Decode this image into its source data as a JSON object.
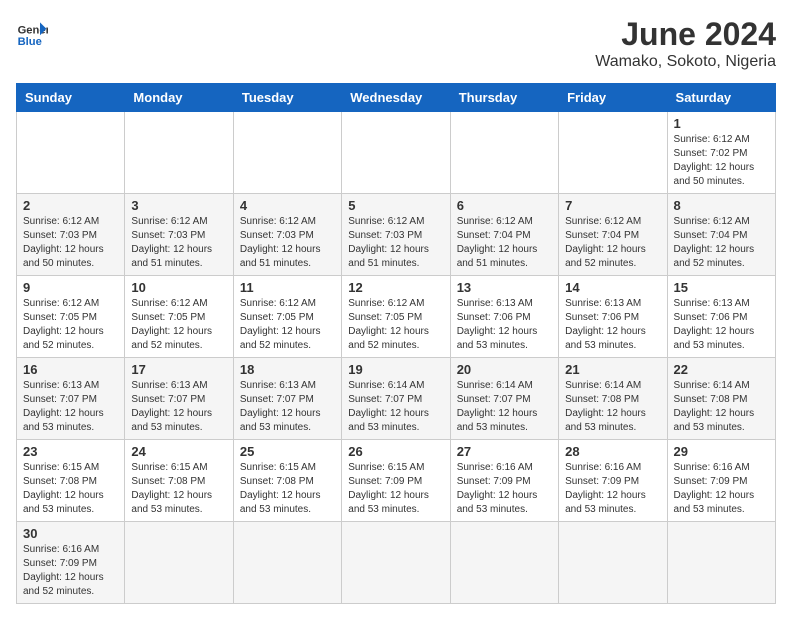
{
  "header": {
    "logo_general": "General",
    "logo_blue": "Blue",
    "title": "June 2024",
    "subtitle": "Wamako, Sokoto, Nigeria"
  },
  "weekdays": [
    "Sunday",
    "Monday",
    "Tuesday",
    "Wednesday",
    "Thursday",
    "Friday",
    "Saturday"
  ],
  "weeks": [
    [
      {
        "day": "",
        "info": ""
      },
      {
        "day": "",
        "info": ""
      },
      {
        "day": "",
        "info": ""
      },
      {
        "day": "",
        "info": ""
      },
      {
        "day": "",
        "info": ""
      },
      {
        "day": "",
        "info": ""
      },
      {
        "day": "1",
        "info": "Sunrise: 6:12 AM\nSunset: 7:02 PM\nDaylight: 12 hours and 50 minutes."
      }
    ],
    [
      {
        "day": "2",
        "info": "Sunrise: 6:12 AM\nSunset: 7:03 PM\nDaylight: 12 hours and 50 minutes."
      },
      {
        "day": "3",
        "info": "Sunrise: 6:12 AM\nSunset: 7:03 PM\nDaylight: 12 hours and 51 minutes."
      },
      {
        "day": "4",
        "info": "Sunrise: 6:12 AM\nSunset: 7:03 PM\nDaylight: 12 hours and 51 minutes."
      },
      {
        "day": "5",
        "info": "Sunrise: 6:12 AM\nSunset: 7:03 PM\nDaylight: 12 hours and 51 minutes."
      },
      {
        "day": "6",
        "info": "Sunrise: 6:12 AM\nSunset: 7:04 PM\nDaylight: 12 hours and 51 minutes."
      },
      {
        "day": "7",
        "info": "Sunrise: 6:12 AM\nSunset: 7:04 PM\nDaylight: 12 hours and 52 minutes."
      },
      {
        "day": "8",
        "info": "Sunrise: 6:12 AM\nSunset: 7:04 PM\nDaylight: 12 hours and 52 minutes."
      }
    ],
    [
      {
        "day": "9",
        "info": "Sunrise: 6:12 AM\nSunset: 7:05 PM\nDaylight: 12 hours and 52 minutes."
      },
      {
        "day": "10",
        "info": "Sunrise: 6:12 AM\nSunset: 7:05 PM\nDaylight: 12 hours and 52 minutes."
      },
      {
        "day": "11",
        "info": "Sunrise: 6:12 AM\nSunset: 7:05 PM\nDaylight: 12 hours and 52 minutes."
      },
      {
        "day": "12",
        "info": "Sunrise: 6:12 AM\nSunset: 7:05 PM\nDaylight: 12 hours and 52 minutes."
      },
      {
        "day": "13",
        "info": "Sunrise: 6:13 AM\nSunset: 7:06 PM\nDaylight: 12 hours and 53 minutes."
      },
      {
        "day": "14",
        "info": "Sunrise: 6:13 AM\nSunset: 7:06 PM\nDaylight: 12 hours and 53 minutes."
      },
      {
        "day": "15",
        "info": "Sunrise: 6:13 AM\nSunset: 7:06 PM\nDaylight: 12 hours and 53 minutes."
      }
    ],
    [
      {
        "day": "16",
        "info": "Sunrise: 6:13 AM\nSunset: 7:07 PM\nDaylight: 12 hours and 53 minutes."
      },
      {
        "day": "17",
        "info": "Sunrise: 6:13 AM\nSunset: 7:07 PM\nDaylight: 12 hours and 53 minutes."
      },
      {
        "day": "18",
        "info": "Sunrise: 6:13 AM\nSunset: 7:07 PM\nDaylight: 12 hours and 53 minutes."
      },
      {
        "day": "19",
        "info": "Sunrise: 6:14 AM\nSunset: 7:07 PM\nDaylight: 12 hours and 53 minutes."
      },
      {
        "day": "20",
        "info": "Sunrise: 6:14 AM\nSunset: 7:07 PM\nDaylight: 12 hours and 53 minutes."
      },
      {
        "day": "21",
        "info": "Sunrise: 6:14 AM\nSunset: 7:08 PM\nDaylight: 12 hours and 53 minutes."
      },
      {
        "day": "22",
        "info": "Sunrise: 6:14 AM\nSunset: 7:08 PM\nDaylight: 12 hours and 53 minutes."
      }
    ],
    [
      {
        "day": "23",
        "info": "Sunrise: 6:15 AM\nSunset: 7:08 PM\nDaylight: 12 hours and 53 minutes."
      },
      {
        "day": "24",
        "info": "Sunrise: 6:15 AM\nSunset: 7:08 PM\nDaylight: 12 hours and 53 minutes."
      },
      {
        "day": "25",
        "info": "Sunrise: 6:15 AM\nSunset: 7:08 PM\nDaylight: 12 hours and 53 minutes."
      },
      {
        "day": "26",
        "info": "Sunrise: 6:15 AM\nSunset: 7:09 PM\nDaylight: 12 hours and 53 minutes."
      },
      {
        "day": "27",
        "info": "Sunrise: 6:16 AM\nSunset: 7:09 PM\nDaylight: 12 hours and 53 minutes."
      },
      {
        "day": "28",
        "info": "Sunrise: 6:16 AM\nSunset: 7:09 PM\nDaylight: 12 hours and 53 minutes."
      },
      {
        "day": "29",
        "info": "Sunrise: 6:16 AM\nSunset: 7:09 PM\nDaylight: 12 hours and 53 minutes."
      }
    ],
    [
      {
        "day": "30",
        "info": "Sunrise: 6:16 AM\nSunset: 7:09 PM\nDaylight: 12 hours and 52 minutes."
      },
      {
        "day": "",
        "info": ""
      },
      {
        "day": "",
        "info": ""
      },
      {
        "day": "",
        "info": ""
      },
      {
        "day": "",
        "info": ""
      },
      {
        "day": "",
        "info": ""
      },
      {
        "day": "",
        "info": ""
      }
    ]
  ]
}
